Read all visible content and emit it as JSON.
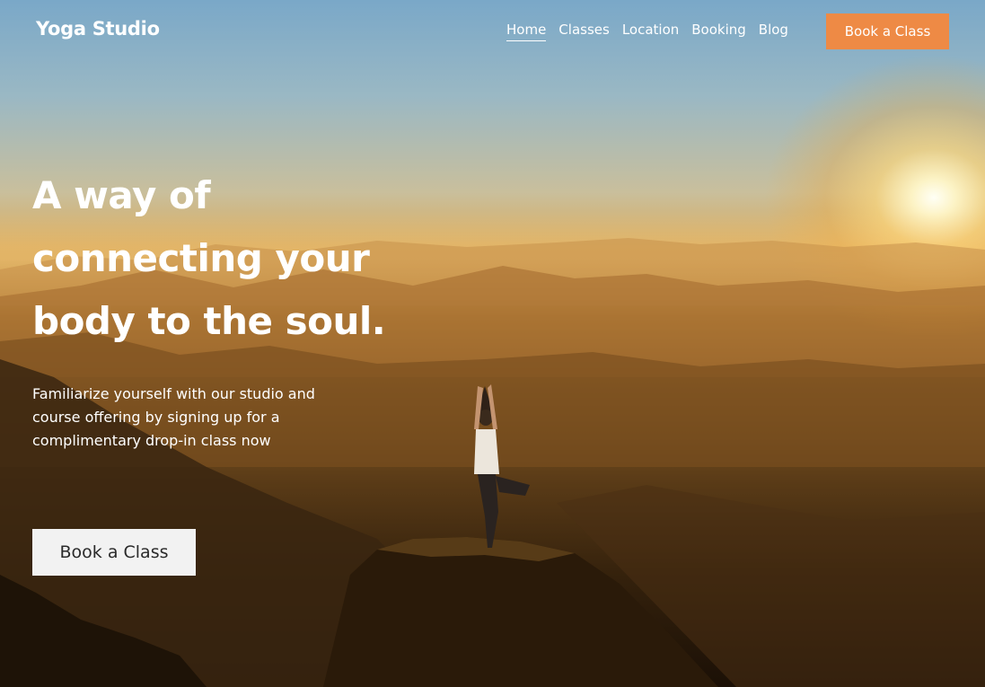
{
  "site": {
    "logo": "Yoga Studio"
  },
  "nav": {
    "links": [
      "Home",
      "Classes",
      "Location",
      "Booking",
      "Blog"
    ],
    "active": "Home",
    "cta_label": "Book a Class",
    "cta_color": "#ee8a45"
  },
  "hero": {
    "headline_lines": [
      "A way of",
      "connecting your",
      "body to the soul."
    ],
    "subtext_lines": [
      "Familiarize yourself with our studio and",
      "course offering by signing up for a",
      "complimentary drop-in class now"
    ],
    "cta_label": "Book a Class",
    "background_image": "yoga-tree-pose-mountain-sunset"
  }
}
